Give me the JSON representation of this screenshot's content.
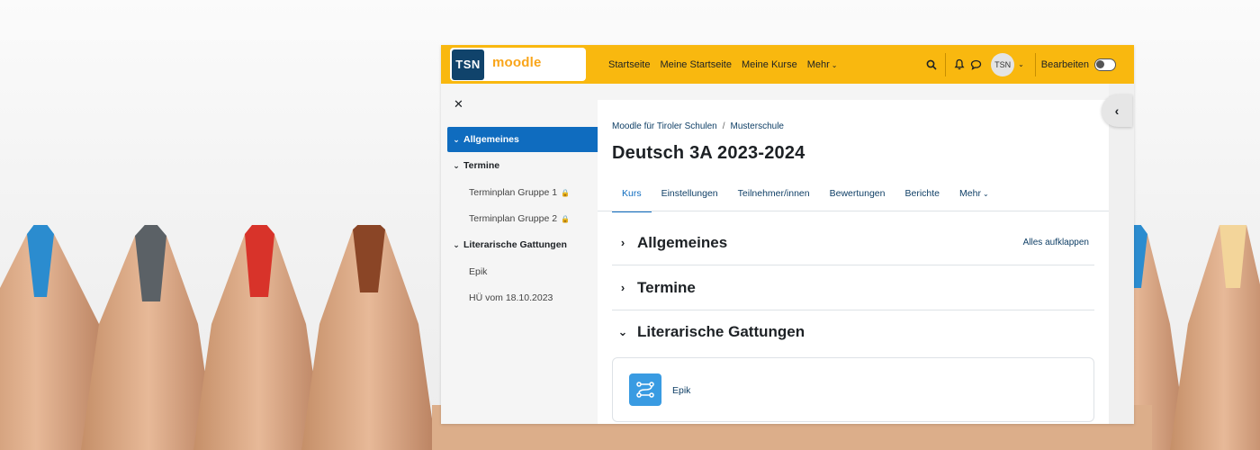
{
  "brand": {
    "logo_short": "TSN",
    "logo_text": "moodle"
  },
  "navbar": {
    "links": [
      "Startseite",
      "Meine Startseite",
      "Meine Kurse",
      "Mehr"
    ],
    "avatar_initials": "TSN",
    "edit_label": "Bearbeiten",
    "edit_mode_on": false
  },
  "drawer": {
    "items": [
      {
        "label": "Allgemeines",
        "type": "section",
        "active": true
      },
      {
        "label": "Termine",
        "type": "section",
        "active": false
      },
      {
        "label": "Terminplan Gruppe 1",
        "type": "activity",
        "locked": true
      },
      {
        "label": "Terminplan Gruppe 2",
        "type": "activity",
        "locked": true
      },
      {
        "label": "Literarische Gattungen",
        "type": "section",
        "active": false
      },
      {
        "label": "Epik",
        "type": "activity",
        "locked": false
      },
      {
        "label": "HÜ vom 18.10.2023",
        "type": "activity",
        "locked": false
      }
    ]
  },
  "breadcrumb": [
    "Moodle für Tiroler Schulen",
    "Musterschule"
  ],
  "course_title": "Deutsch 3A 2023-2024",
  "tabs": [
    "Kurs",
    "Einstellungen",
    "Teilnehmer/innen",
    "Bewertungen",
    "Berichte",
    "Mehr"
  ],
  "sections": [
    {
      "title": "Allgemeines",
      "expanded": false
    },
    {
      "title": "Termine",
      "expanded": false
    },
    {
      "title": "Literarische Gattungen",
      "expanded": true
    }
  ],
  "expand_all_label": "Alles aufklappen",
  "activities": [
    {
      "label": "Epik",
      "icon": "lesson-path-icon"
    }
  ],
  "colors": {
    "navbar": "#f9b80f",
    "primary": "#0f6cbf",
    "activity_icon": "#399be2",
    "logo_blue": "#10436b"
  }
}
